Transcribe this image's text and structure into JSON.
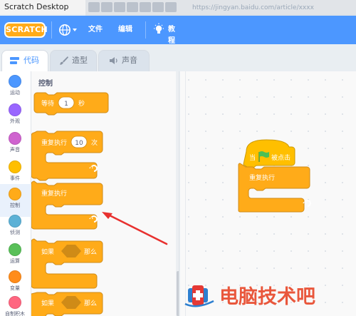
{
  "window": {
    "title": "Scratch Desktop",
    "blurred_url": "https://jingyan.baidu.com/article/xxxx"
  },
  "menubar": {
    "logo": "SCRATCH",
    "file": "文件",
    "edit": "编辑",
    "tutorials": "教程"
  },
  "tabs": [
    {
      "label": "代码",
      "active": true
    },
    {
      "label": "造型",
      "active": false
    },
    {
      "label": "声音",
      "active": false
    }
  ],
  "categories": [
    {
      "label": "运动",
      "color": "#4c97ff"
    },
    {
      "label": "外观",
      "color": "#9966ff"
    },
    {
      "label": "声音",
      "color": "#cf63cf"
    },
    {
      "label": "事件",
      "color": "#ffbf00"
    },
    {
      "label": "控制",
      "color": "#ffab19",
      "selected": true
    },
    {
      "label": "侦测",
      "color": "#5cb1d6"
    },
    {
      "label": "运算",
      "color": "#59c059"
    },
    {
      "label": "变量",
      "color": "#ff8c1a"
    },
    {
      "label": "自制积木",
      "color": "#ff6680"
    }
  ],
  "palette": {
    "title": "控制",
    "blocks": {
      "wait": {
        "label": "等待",
        "value": "1",
        "unit": "秒"
      },
      "repeat": {
        "label": "重复执行",
        "value": "10",
        "unit": "次"
      },
      "forever": {
        "label": "重复执行"
      },
      "if_then": {
        "label_if": "如果",
        "label_then": "那么"
      },
      "if_then_else": {
        "label_if": "如果",
        "label_then": "那么"
      }
    }
  },
  "workspace": {
    "hat": {
      "label_when": "当",
      "label_clicked": "被点击"
    },
    "forever": {
      "label": "重复执行"
    }
  },
  "watermark": {
    "text": "电脑技术吧"
  },
  "colors": {
    "control_block": "#ffab19",
    "control_border": "#cf8b17",
    "menubar": "#4c97ff",
    "arrow": "#e8312f"
  }
}
